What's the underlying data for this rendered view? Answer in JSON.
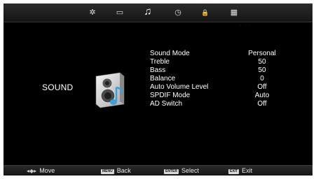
{
  "tabs": [
    {
      "name": "picture-tab",
      "icon": "gear-icon",
      "glyph": "✲"
    },
    {
      "name": "screen-tab",
      "icon": "monitor-icon",
      "glyph": "▭"
    },
    {
      "name": "sound-tab",
      "icon": "music-note-icon",
      "glyph": "♫",
      "active": true
    },
    {
      "name": "time-tab",
      "icon": "clock-icon",
      "glyph": "◷"
    },
    {
      "name": "lock-tab",
      "icon": "lock-icon",
      "glyph": "🔒"
    },
    {
      "name": "setup-tab",
      "icon": "grid-icon",
      "glyph": "▦"
    }
  ],
  "section": {
    "title": "SOUND",
    "icon": "speaker-icon"
  },
  "menu": [
    {
      "label": "Sound Mode",
      "value": "Personal"
    },
    {
      "label": "Treble",
      "value": "50"
    },
    {
      "label": "Bass",
      "value": "50"
    },
    {
      "label": "Balance",
      "value": "0"
    },
    {
      "label": "Auto Volume Level",
      "value": "Off"
    },
    {
      "label": "SPDIF Mode",
      "value": "Auto"
    },
    {
      "label": "AD Switch",
      "value": "Off"
    }
  ],
  "footer": {
    "move": {
      "label": "Move",
      "icon": "dpad-icon"
    },
    "back": {
      "key": "MENU",
      "label": "Back"
    },
    "select": {
      "key": "ENTER",
      "label": "Select"
    },
    "exit": {
      "key": "EXIT",
      "label": "Exit"
    }
  },
  "colors": {
    "background": "#000000",
    "text": "#ffffff",
    "bar": "#222222"
  }
}
